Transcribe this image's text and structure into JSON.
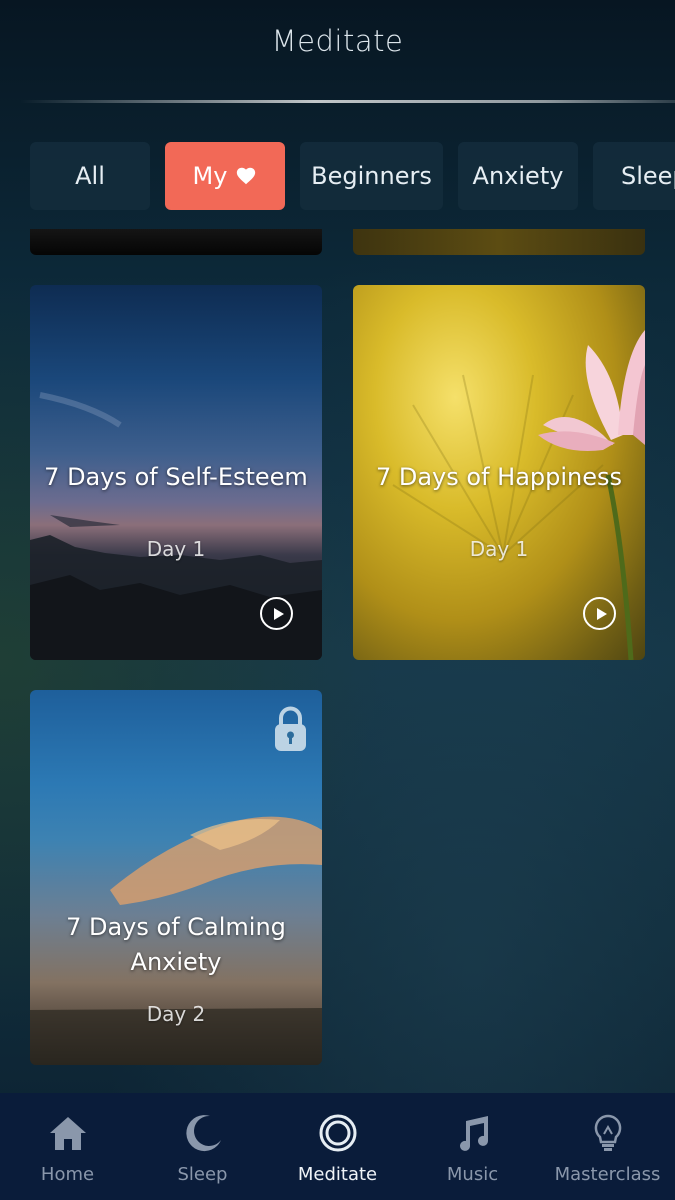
{
  "header": {
    "title": "Meditate"
  },
  "tabs": [
    {
      "label": "All",
      "active": false
    },
    {
      "label": "My",
      "active": true,
      "icon": "heart-icon"
    },
    {
      "label": "Beginners",
      "active": false
    },
    {
      "label": "Anxiety",
      "active": false
    },
    {
      "label": "Sleep",
      "active": false
    }
  ],
  "cards": [
    {
      "title": "7 Days of Self-Esteem",
      "day": "Day 1",
      "action_icon": "play-icon"
    },
    {
      "title": "7 Days of Happiness",
      "day": "Day 1",
      "action_icon": "play-icon"
    },
    {
      "title_line1": "7 Days of Calming",
      "title_line2": "Anxiety",
      "day": "Day 2",
      "action_icon": "lock-icon"
    }
  ],
  "bottom_nav": [
    {
      "label": "Home",
      "icon": "home-icon",
      "active": false
    },
    {
      "label": "Sleep",
      "icon": "moon-icon",
      "active": false
    },
    {
      "label": "Meditate",
      "icon": "meditate-circle-icon",
      "active": true
    },
    {
      "label": "Music",
      "icon": "music-note-icon",
      "active": false
    },
    {
      "label": "Masterclass",
      "icon": "lightbulb-icon",
      "active": false
    }
  ],
  "colors": {
    "accent": "#f26957",
    "nav_bg": "#0a1c3a",
    "nav_inactive": "#8a97ab"
  }
}
